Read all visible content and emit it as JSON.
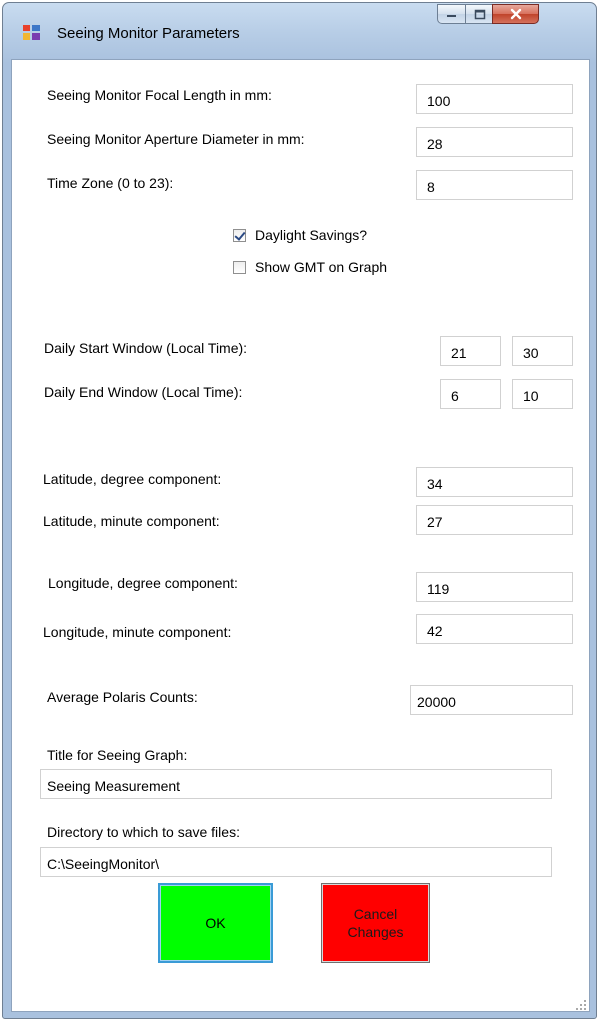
{
  "window": {
    "title": "Seeing Monitor Parameters"
  },
  "fields": {
    "focal_length": {
      "label": "Seeing Monitor Focal Length in mm:",
      "value": "100"
    },
    "aperture": {
      "label": "Seeing Monitor Aperture Diameter in mm:",
      "value": "28"
    },
    "time_zone": {
      "label": "Time Zone (0 to 23):",
      "value": "8"
    },
    "daylight_savings": {
      "label": "Daylight Savings?",
      "checked": true
    },
    "show_gmt": {
      "label": "Show GMT on Graph",
      "checked": false
    },
    "start_window": {
      "label": "Daily Start Window (Local Time):",
      "hour": "21",
      "minute": "30"
    },
    "end_window": {
      "label": "Daily End Window (Local Time):",
      "hour": "6",
      "minute": "10"
    },
    "lat_deg": {
      "label": "Latitude, degree component:",
      "value": "34"
    },
    "lat_min": {
      "label": "Latitude, minute component:",
      "value": "27"
    },
    "lon_deg": {
      "label": "Longitude, degree component:",
      "value": "119"
    },
    "lon_min": {
      "label": "Longitude, minute component:",
      "value": "42"
    },
    "polaris": {
      "label": "Average Polaris Counts:",
      "value": "20000"
    },
    "graph_title": {
      "label": "Title for Seeing Graph:",
      "value": "Seeing Measurement"
    },
    "save_dir": {
      "label": "Directory to which to save files:",
      "value": "C:\\SeeingMonitor\\"
    }
  },
  "buttons": {
    "ok": "OK",
    "cancel_line1": "Cancel",
    "cancel_line2": "Changes"
  },
  "colors": {
    "ok": "#00ff00",
    "cancel": "#ff0000",
    "focus_border": "#3a9bd6"
  }
}
